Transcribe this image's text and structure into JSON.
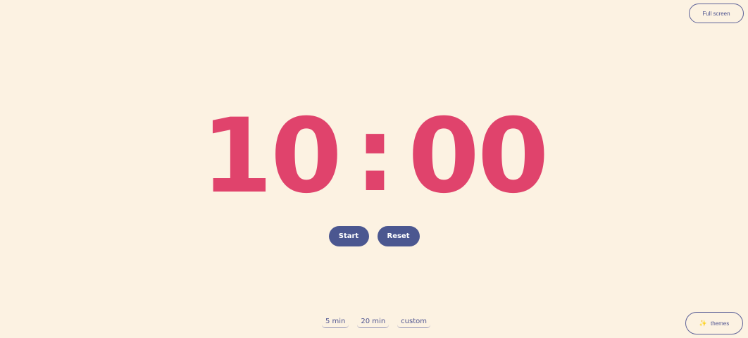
{
  "header": {
    "fullscreen_label": "Full screen"
  },
  "timer": {
    "minutes": "10",
    "separator": ":",
    "seconds": "00"
  },
  "controls": {
    "start_label": "Start",
    "reset_label": "Reset"
  },
  "presets": [
    {
      "label": "5 min"
    },
    {
      "label": "20 min"
    },
    {
      "label": "custom"
    }
  ],
  "footer": {
    "themes_icon": "sparkle-icon",
    "themes_label": "themes"
  },
  "colors": {
    "background": "#fcf1e1",
    "timer": "#e0436c",
    "accent": "#4b5790",
    "outline": "#5d6298"
  }
}
